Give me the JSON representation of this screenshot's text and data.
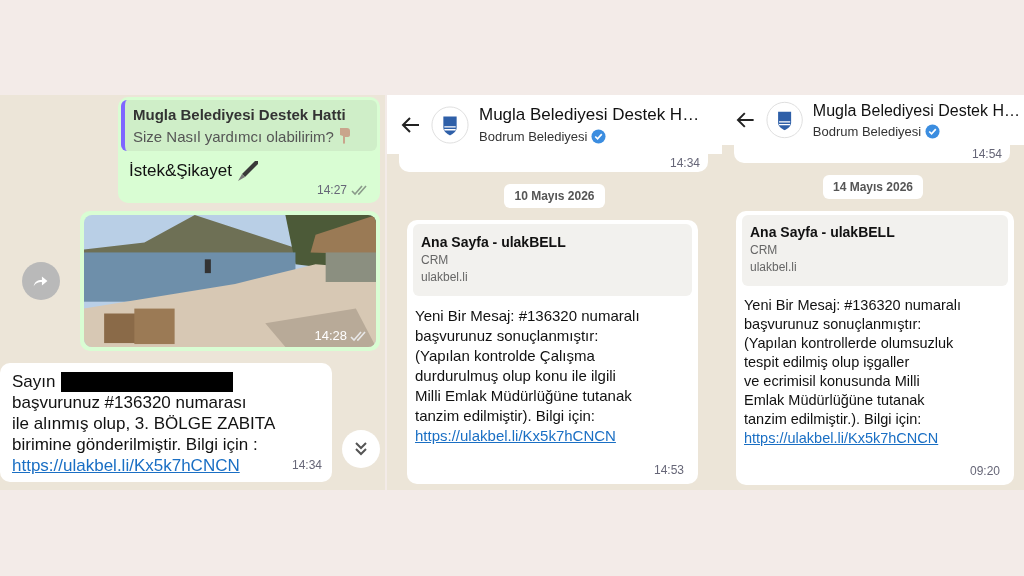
{
  "chat_1": {
    "messages": [
      {
        "kind": "reply",
        "quote_title": "Mugla Belediyesi Destek Hatti",
        "quote_text": "Size Nasıl yardımcı olabilirim?",
        "text": "İstek&Şikayet",
        "time": "14:27"
      },
      {
        "time": "14:28"
      },
      {
        "kind": "incoming",
        "salutation": "Sayın",
        "text": "başvurunuz #136320 numarası\nile alınmış olup, 3. BÖLGE ZABITA\nbirimine gönderilmiştir. Bilgi için :",
        "link": "https://ulakbel.li/Kx5k7hCNCN",
        "time": "14:34"
      }
    ]
  },
  "chat_screens": [
    {
      "header": {
        "title": "Mugla Belediyesi Destek H…",
        "subtitle": "Bodrum Belediyesi"
      },
      "previous_time": "14:34",
      "date": "10 Mayıs 2026",
      "message": {
        "preview": {
          "title": "Ana Sayfa - ulakBELL",
          "description": "CRM",
          "domain": "ulakbel.li"
        },
        "text": "Yeni Bir Mesaj: #136320 numaralı\nbaşvurunuz sonuçlanmıştır:\n(Yapılan kontrolde Çalışma\ndurdurulmuş olup konu ile ilgili\nMilli Emlak Müdürlüğüne tutanak\ntanzim edilmiştir). Bilgi için:",
        "link": "https://ulakbel.li/Kx5k7hCNCN",
        "time": "14:53"
      }
    },
    {
      "header": {
        "title": "Mugla Belediyesi Destek H…",
        "subtitle": "Bodrum Belediyesi"
      },
      "previous_time": "14:54",
      "date": "14 Mayıs 2026",
      "message": {
        "preview": {
          "title": "Ana Sayfa - ulakBELL",
          "description": "CRM",
          "domain": "ulakbel.li"
        },
        "text": "Yeni Bir Mesaj: #136320 numaralı\nbaşvurunuz sonuçlanmıştır:\n(Yapılan kontrollerde olumsuzluk\ntespit edilmiş olup işgaller\nve ecrimisil konusunda Milli\nEmlak Müdürlüğüne tutanak\ntanzim edilmiştir.). Bilgi için:",
        "link": "https://ulakbel.li/Kx5k7hCNCN",
        "time": "09:20"
      }
    }
  ]
}
